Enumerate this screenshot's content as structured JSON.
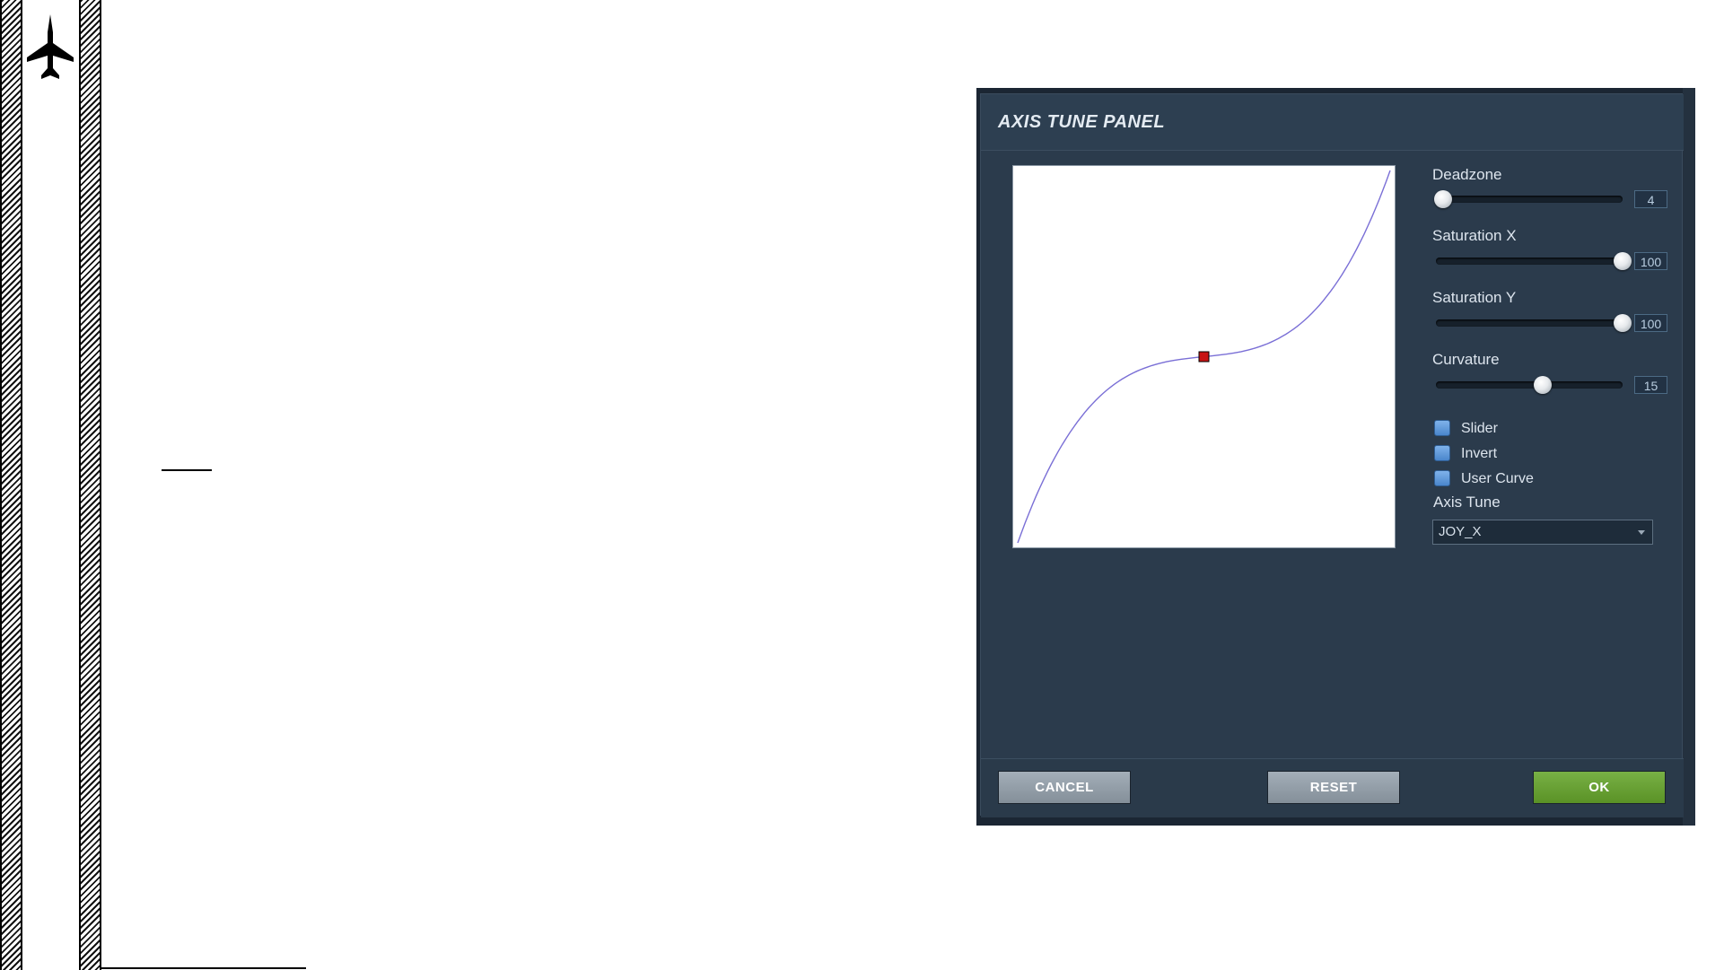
{
  "dialog": {
    "title": "AXIS TUNE PANEL",
    "sliders": [
      {
        "label": "Deadzone",
        "value": "4",
        "fraction": 0.04
      },
      {
        "label": "Saturation X",
        "value": "100",
        "fraction": 1.0
      },
      {
        "label": "Saturation Y",
        "value": "100",
        "fraction": 1.0
      },
      {
        "label": "Curvature",
        "value": "15",
        "fraction": 0.57
      }
    ],
    "checkboxes": [
      {
        "label": "Slider"
      },
      {
        "label": "Invert"
      },
      {
        "label": "User Curve"
      }
    ],
    "axis_tune": {
      "label": "Axis Tune",
      "selected": "JOY_X"
    },
    "buttons": {
      "cancel": "CANCEL",
      "reset": "RESET",
      "ok": "OK"
    },
    "colors": {
      "panel": "#2b3b4c",
      "ok_button": "#6aa234",
      "gray_button": "#929da7",
      "curve": "#7a6fd6",
      "marker": "#c81414"
    }
  },
  "icons": {
    "document": "jet-icon"
  }
}
